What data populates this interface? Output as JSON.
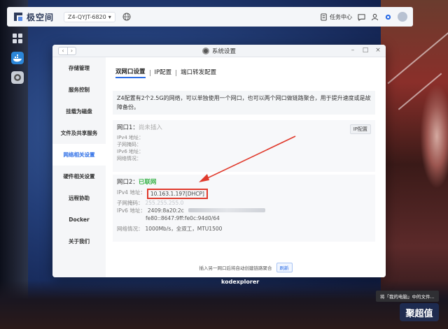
{
  "app": {
    "logo_text": "极空间",
    "device_name": "Z4-QYJT-6820"
  },
  "topbar": {
    "task_center": "任务中心"
  },
  "window": {
    "title": "系统设置"
  },
  "sidebar": {
    "items": [
      {
        "label": "存储管理"
      },
      {
        "label": "服务控制"
      },
      {
        "label": "挂载为磁盘"
      },
      {
        "label": "文件及共享服务"
      },
      {
        "label": "网络相关设置"
      },
      {
        "label": "硬件相关设置"
      },
      {
        "label": "远程协助"
      },
      {
        "label": "Docker"
      },
      {
        "label": "关于我们"
      }
    ],
    "active_index": 4
  },
  "tabs": [
    {
      "label": "双网口设置"
    },
    {
      "label": "IP配置"
    },
    {
      "label": "端口转发配置"
    }
  ],
  "description": "Z4配置有2个2.5G的网络，可以单独使用一个网口，也可以两个网口做链路聚合，用于提升速度或是故障备份。",
  "port1": {
    "title": "网口1：",
    "status": "尚未插入",
    "ipv4_label": "IPv4 地址：",
    "mask_label": "子网掩码：",
    "ipv6_label": "IPv6 地址：",
    "net_label": "网络情况：",
    "ip_button": "IP配置"
  },
  "port2": {
    "title": "网口2：",
    "status": "已联网",
    "ipv4_label": "IPv4 地址：",
    "ipv4_value": "10.163.1.197[DHCP]",
    "mask_label": "子网掩码：",
    "mask_value": "255.255.255.0",
    "ipv6_label": "IPv6 地址：",
    "ipv6_value1": "2409:8a20:2c",
    "ipv6_value2": "fe80::8647:9ff:fe0c:94d0/64",
    "net_label": "网络情况：",
    "net_value": "1000Mb/s，全双工，MTU1500"
  },
  "bottom": {
    "note": "插入另一网口后将自动创建链路聚合",
    "refresh": "刷新"
  },
  "desktop": {
    "dock_label": "kodexplorer",
    "tooltip": "将「我的电脑」中的文件..."
  },
  "watermark": "聚超值",
  "colors": {
    "accent": "#2d6ee6",
    "online": "#3ab34a",
    "highlight": "#e03a2c"
  }
}
